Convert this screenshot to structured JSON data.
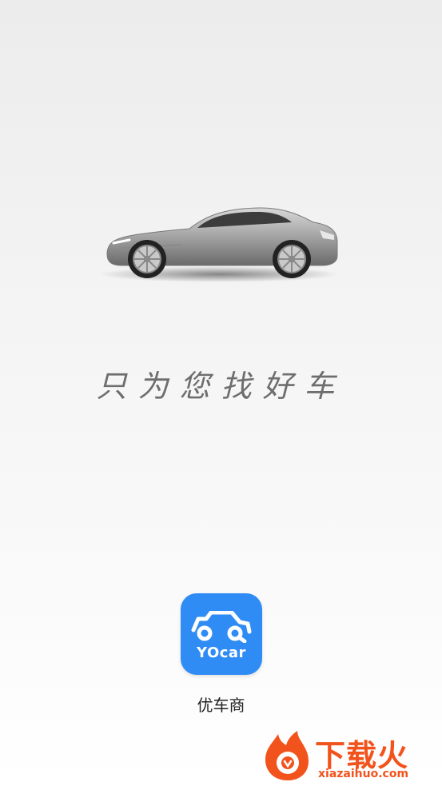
{
  "splash": {
    "slogan": "只为您找好车"
  },
  "app": {
    "icon_brand": "YOcar",
    "name": "优车商"
  },
  "watermark": {
    "title": "下载火",
    "url": "xiazaihuo.com"
  },
  "colors": {
    "app_icon_bg": "#2f8cf4",
    "watermark": "#f2531c",
    "slogan": "#6e6e6e"
  },
  "icons": [
    "car-image",
    "car-search-icon",
    "fire-logo-icon"
  ]
}
